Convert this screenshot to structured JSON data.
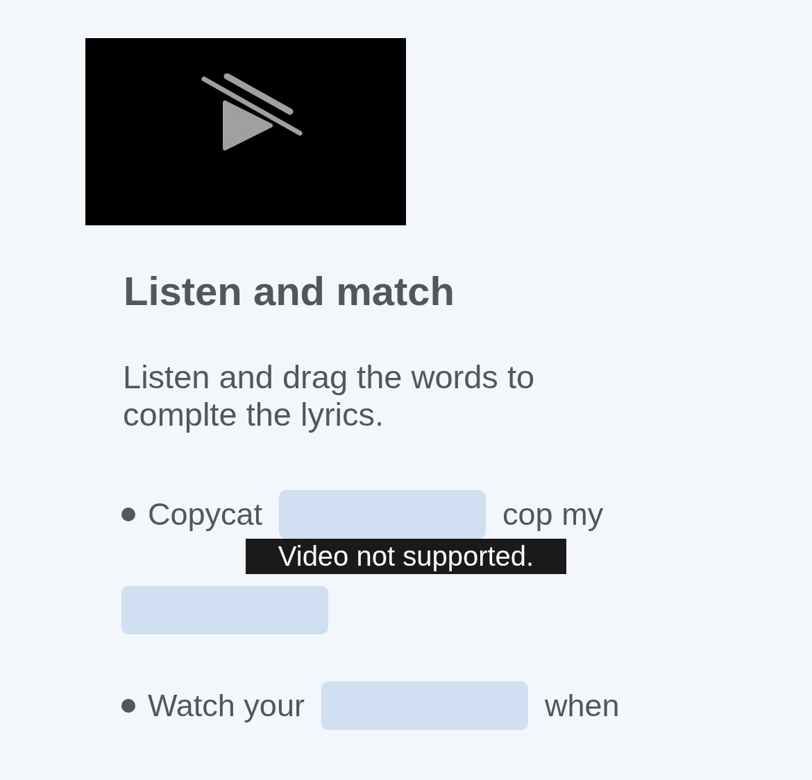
{
  "video": {
    "kind": "unavailable"
  },
  "title": "Listen and match",
  "instructions": "Listen and drag the words to complte the lyrics.",
  "items": [
    {
      "segments": [
        {
          "kind": "text",
          "text": "Copycat"
        },
        {
          "kind": "blank"
        },
        {
          "kind": "text",
          "text": "cop my"
        },
        {
          "kind": "blank"
        }
      ]
    },
    {
      "segments": [
        {
          "kind": "text",
          "text": "Watch your"
        },
        {
          "kind": "blank"
        },
        {
          "kind": "text",
          "text": "when"
        }
      ]
    }
  ],
  "toast": {
    "text": "Video not supported."
  }
}
